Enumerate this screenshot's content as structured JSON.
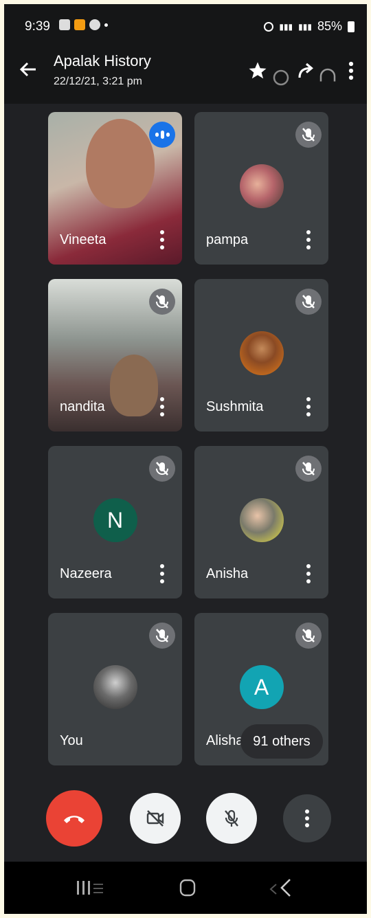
{
  "status_bar": {
    "time": "9:39",
    "battery": "85%"
  },
  "header": {
    "title": "Apalak History",
    "subtitle": "22/12/21, 3:21 pm"
  },
  "participants": [
    {
      "name": "Vineeta",
      "state": "speaking",
      "media": "video"
    },
    {
      "name": "pampa",
      "state": "muted",
      "media": "photo"
    },
    {
      "name": "nandita",
      "state": "muted",
      "media": "video"
    },
    {
      "name": "Sushmita",
      "state": "muted",
      "media": "photo"
    },
    {
      "name": "Nazeera",
      "state": "muted",
      "media": "letter",
      "letter": "N",
      "color": "#0f5f4b"
    },
    {
      "name": "Anisha",
      "state": "muted",
      "media": "photo"
    },
    {
      "name": "You",
      "state": "muted",
      "media": "photo"
    },
    {
      "name": "Alisha",
      "state": "muted",
      "media": "letter",
      "letter": "A",
      "color": "#12a4b3"
    }
  ],
  "overflow": {
    "label": "91 others"
  },
  "controls": {
    "end_call": "end-call",
    "camera": "camera-off",
    "mic": "mic-off",
    "more": "more"
  },
  "colors": {
    "end_call": "#ea4335",
    "tile": "#3c4043",
    "speaking": "#1a73e8"
  }
}
